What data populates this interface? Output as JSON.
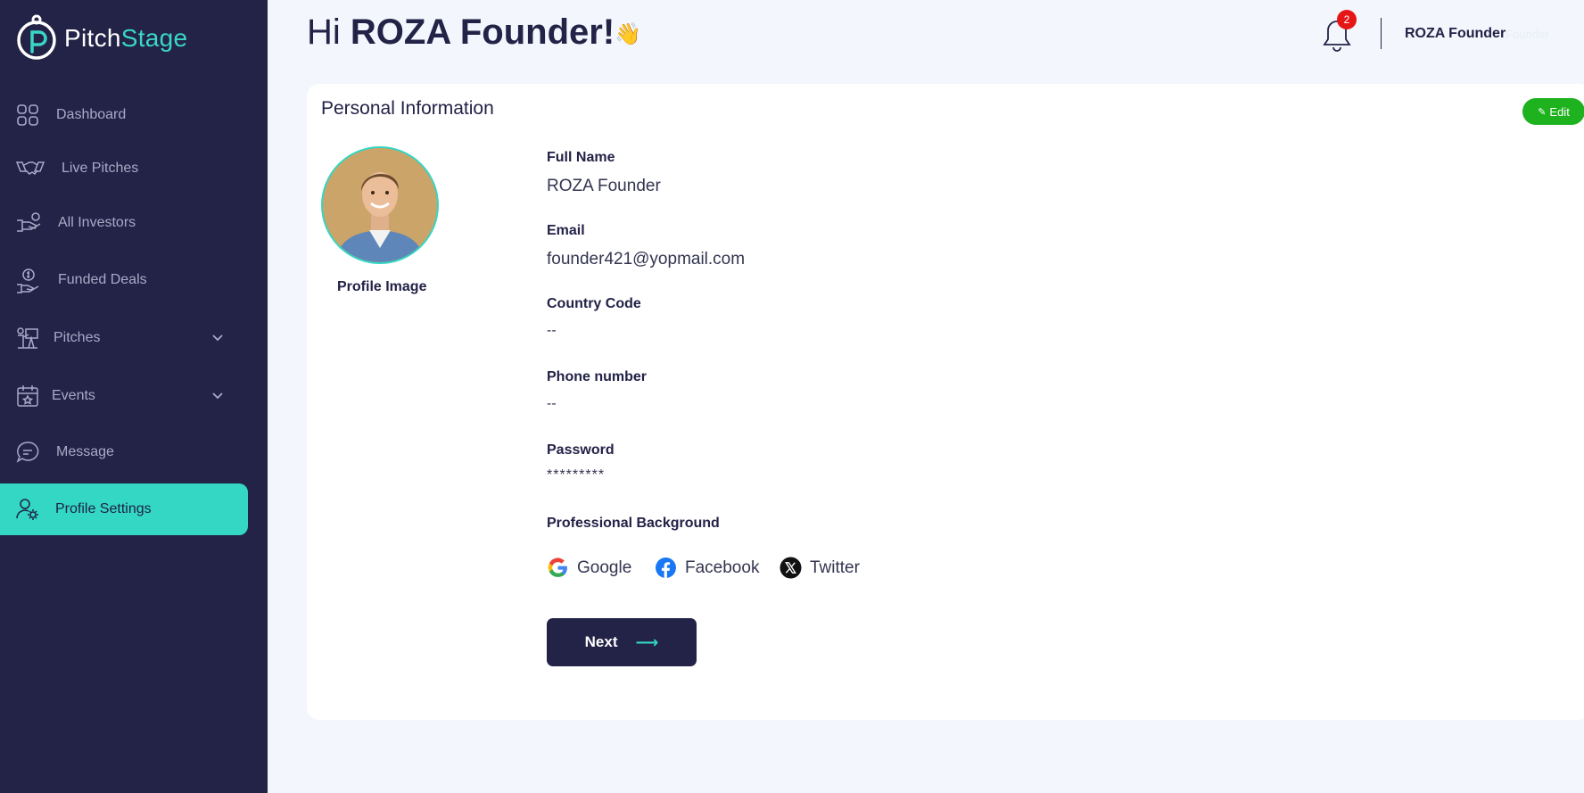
{
  "brand": {
    "name_part1": "Pitch",
    "name_part2": "Stage",
    "accent": "#39d7c3",
    "sidebar_bg": "#232247"
  },
  "sidebar": {
    "items": [
      {
        "label": "Dashboard",
        "icon": "dashboard-grid-icon"
      },
      {
        "label": "Live Pitches",
        "icon": "handshake-icon"
      },
      {
        "label": "All Investors",
        "icon": "investor-hand-icon"
      },
      {
        "label": "Funded Deals",
        "icon": "money-hand-icon"
      },
      {
        "label": "Pitches",
        "icon": "presentation-icon",
        "expandable": true
      },
      {
        "label": "Events",
        "icon": "calendar-star-icon",
        "expandable": true
      },
      {
        "label": "Message",
        "icon": "chat-icon"
      },
      {
        "label": "Profile Settings",
        "icon": "user-gear-icon",
        "active": true
      }
    ]
  },
  "header": {
    "greeting": "Hi",
    "user_name": "ROZA Founder!",
    "wave": "👋",
    "notification_count": "2",
    "account_name": "ROZA Founder",
    "account_role": "Founder"
  },
  "profile": {
    "section_title": "Personal Information",
    "edit_label": "Edit",
    "image_label": "Profile Image",
    "fields": {
      "full_name": {
        "label": "Full Name",
        "value": "ROZA Founder"
      },
      "email": {
        "label": "Email",
        "value": "founder421@yopmail.com"
      },
      "country_code": {
        "label": "Country Code",
        "value": "--"
      },
      "phone": {
        "label": "Phone number",
        "value": "--"
      },
      "password": {
        "label": "Password",
        "value": "*********"
      }
    },
    "background_label": "Professional Background",
    "social": [
      "Google",
      "Facebook",
      "Twitter"
    ],
    "next_label": "Next",
    "next_arrow": "⟶"
  }
}
